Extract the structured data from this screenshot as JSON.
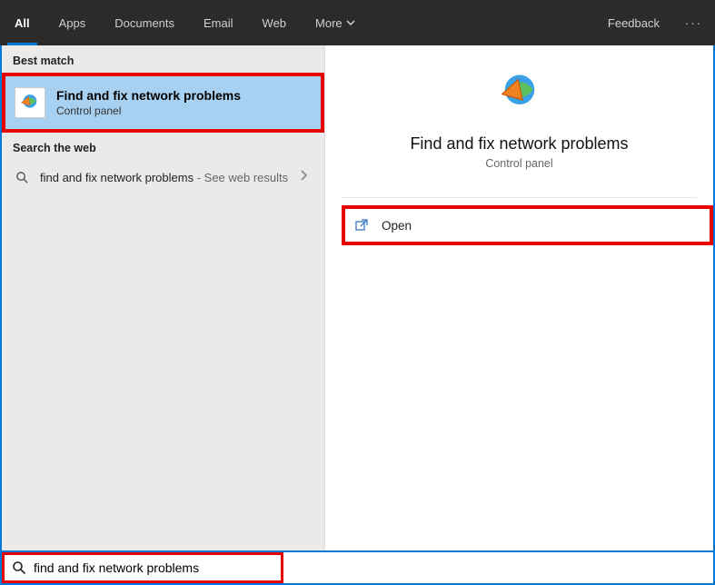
{
  "tabs": {
    "all": "All",
    "apps": "Apps",
    "documents": "Documents",
    "email": "Email",
    "web": "Web",
    "more": "More"
  },
  "feedback": "Feedback",
  "sections": {
    "best_match": "Best match",
    "search_web": "Search the web"
  },
  "best_match": {
    "title": "Find and fix network problems",
    "subtitle": "Control panel"
  },
  "web_result": {
    "query": "find and fix network problems",
    "suffix": " - See web results"
  },
  "detail": {
    "title": "Find and fix network problems",
    "subtitle": "Control panel",
    "open": "Open"
  },
  "search": {
    "value": "find and fix network problems"
  },
  "colors": {
    "accent": "#0078d7",
    "highlight": "#e60000",
    "selected_bg": "#a8d0f0"
  }
}
